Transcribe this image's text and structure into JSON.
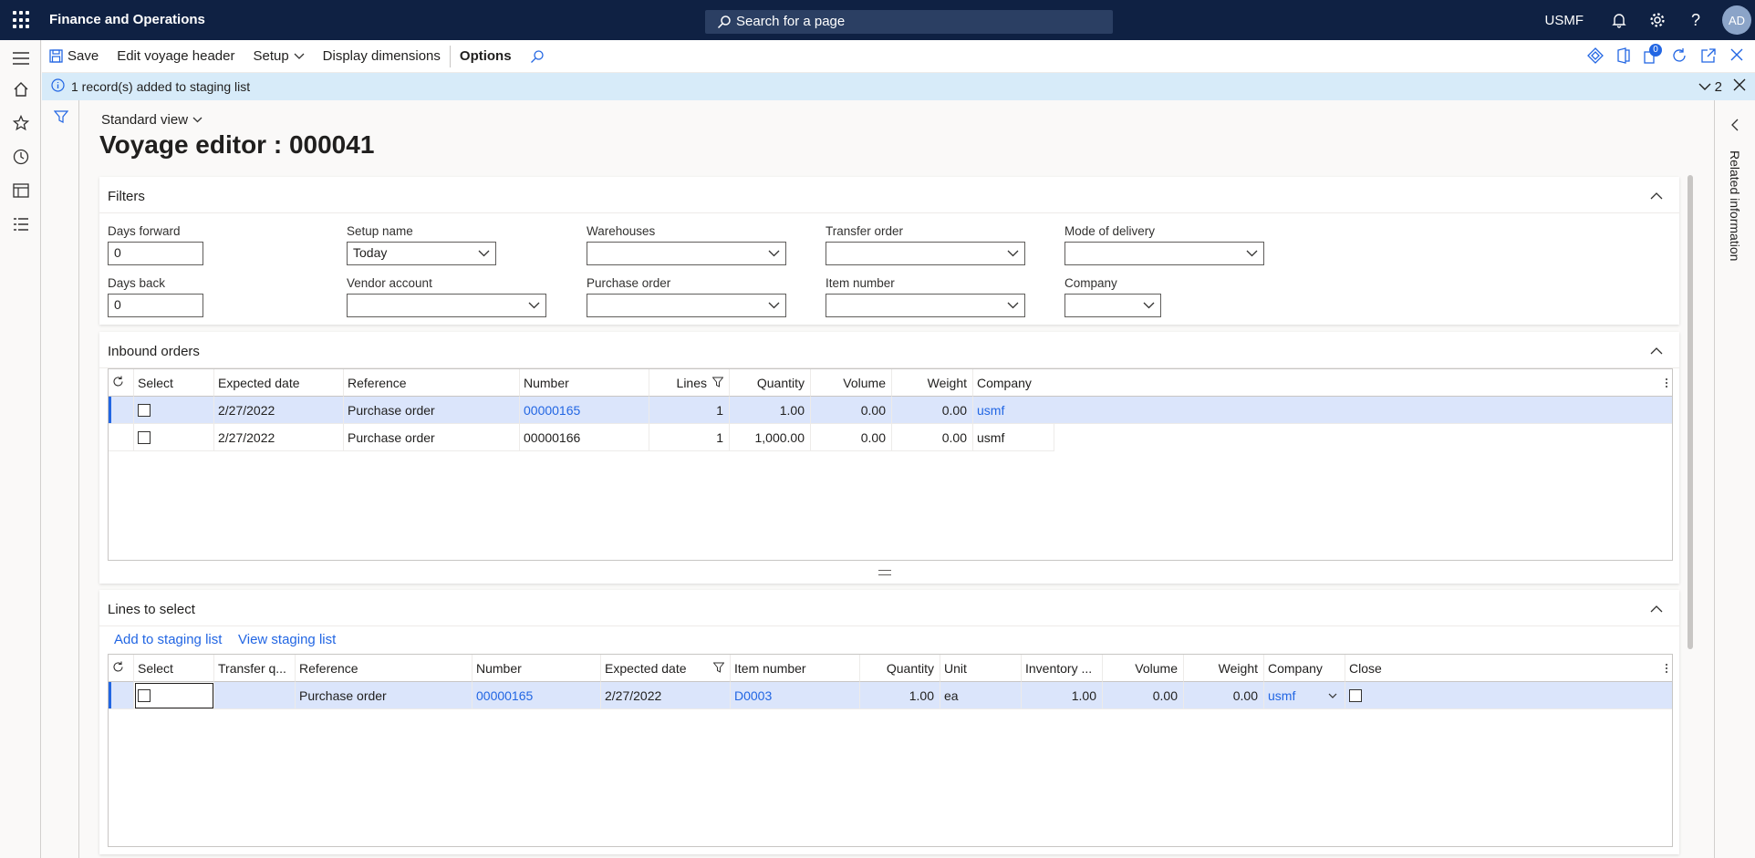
{
  "topbar": {
    "app_title": "Finance and Operations",
    "search_placeholder": "Search for a page",
    "company": "USMF",
    "avatar_initials": "AD"
  },
  "actionbar": {
    "save": "Save",
    "edit_voyage_header": "Edit voyage header",
    "setup": "Setup",
    "display_dimensions": "Display dimensions",
    "options": "Options",
    "notif_count": "0"
  },
  "message": {
    "text": "1 record(s) added to staging list",
    "count": "2"
  },
  "right_pane": {
    "label": "Related information"
  },
  "view": {
    "name": "Standard view"
  },
  "page": {
    "title": "Voyage editor : 000041"
  },
  "filters": {
    "title": "Filters",
    "days_forward_label": "Days forward",
    "days_forward_value": "0",
    "days_back_label": "Days back",
    "days_back_value": "0",
    "setup_name_label": "Setup name",
    "setup_name_value": "Today",
    "vendor_account_label": "Vendor account",
    "vendor_account_value": "",
    "warehouses_label": "Warehouses",
    "warehouses_value": "",
    "purchase_order_label": "Purchase order",
    "purchase_order_value": "",
    "transfer_order_label": "Transfer order",
    "transfer_order_value": "",
    "item_number_label": "Item number",
    "item_number_value": "",
    "mode_of_delivery_label": "Mode of delivery",
    "mode_of_delivery_value": "",
    "company_label": "Company",
    "company_value": ""
  },
  "inbound": {
    "title": "Inbound orders",
    "headers": {
      "select": "Select",
      "expected_date": "Expected date",
      "reference": "Reference",
      "number": "Number",
      "lines": "Lines",
      "quantity": "Quantity",
      "volume": "Volume",
      "weight": "Weight",
      "company": "Company"
    },
    "rows": [
      {
        "expected_date": "2/27/2022",
        "reference": "Purchase order",
        "number": "00000165",
        "lines": "1",
        "quantity": "1.00",
        "volume": "0.00",
        "weight": "0.00",
        "company": "usmf"
      },
      {
        "expected_date": "2/27/2022",
        "reference": "Purchase order",
        "number": "00000166",
        "lines": "1",
        "quantity": "1,000.00",
        "volume": "0.00",
        "weight": "0.00",
        "company": "usmf"
      }
    ]
  },
  "lines": {
    "title": "Lines to select",
    "add_to_staging": "Add to staging list",
    "view_staging": "View staging list",
    "headers": {
      "select": "Select",
      "transfer_q": "Transfer q...",
      "reference": "Reference",
      "number": "Number",
      "expected_date": "Expected date",
      "item_number": "Item number",
      "quantity": "Quantity",
      "unit": "Unit",
      "inventory": "Inventory ...",
      "volume": "Volume",
      "weight": "Weight",
      "company": "Company",
      "close": "Close"
    },
    "rows": [
      {
        "transfer_q": "",
        "reference": "Purchase order",
        "number": "00000165",
        "expected_date": "2/27/2022",
        "item_number": "D0003",
        "quantity": "1.00",
        "unit": "ea",
        "inventory": "1.00",
        "volume": "0.00",
        "weight": "0.00",
        "company": "usmf"
      }
    ]
  }
}
